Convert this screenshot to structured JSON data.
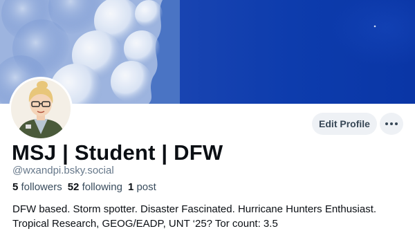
{
  "profile": {
    "display_name": "MSJ | Student | DFW",
    "handle": "@wxandpi.bsky.social",
    "followers_count": "5",
    "followers_label": "followers",
    "following_count": "52",
    "following_label": "following",
    "posts_count": "1",
    "posts_label": "post",
    "bio_line1": "DFW based. Storm spotter. Disaster Fascinated. Hurricane Hunters Enthusiast.",
    "bio_line2": "Tropical Research, GEOG/EADP, UNT ‘25? Tor count: 3.5"
  },
  "actions": {
    "edit_profile_label": "Edit Profile",
    "more_icon": "ellipsis-icon"
  },
  "colors": {
    "banner_sky": "#0d3cad",
    "button_bg": "#eef1f5",
    "handle_text": "#66788a"
  }
}
